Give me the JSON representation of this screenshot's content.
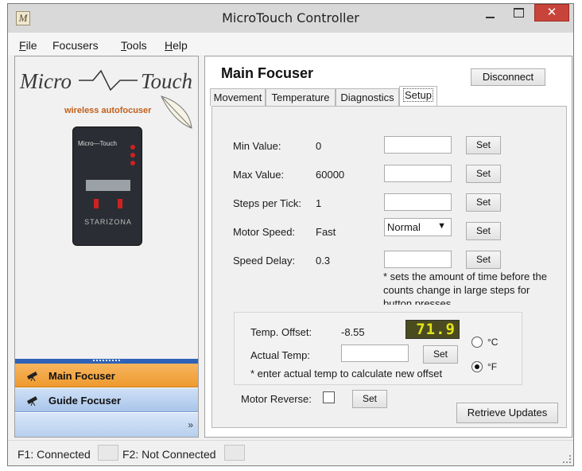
{
  "window": {
    "title": "MicroTouch Controller",
    "icon_letter": "M",
    "close_glyph": "✕"
  },
  "menu": [
    {
      "accel": "F",
      "rest": "ile"
    },
    {
      "accel": "",
      "rest": "Focusers"
    },
    {
      "accel": "T",
      "rest": "ools"
    },
    {
      "accel": "H",
      "rest": "elp"
    }
  ],
  "logo": {
    "part1": "Micro",
    "part2": "Touch",
    "tagline": "wireless autofocuser",
    "device_logo": "Micro—Touch",
    "device_brand": "STARIZONA"
  },
  "nav": {
    "main": "Main Focuser",
    "guide": "Guide Focuser",
    "more": "»"
  },
  "main": {
    "title": "Main Focuser",
    "disconnect": "Disconnect",
    "tabs": [
      "Movement",
      "Temperature",
      "Diagnostics",
      "Setup"
    ],
    "active_tab": "Setup"
  },
  "setup": {
    "min_label": "Min Value:",
    "min_value": "0",
    "max_label": "Max Value:",
    "max_value": "60000",
    "steps_label": "Steps per Tick:",
    "steps_value": "1",
    "speed_label": "Motor Speed:",
    "speed_value": "Fast",
    "speed_select": "Normal",
    "delay_label": "Speed Delay:",
    "delay_value": "0.3",
    "set": "Set",
    "delay_note": "* sets the amount of time before the counts change in large steps for button presses"
  },
  "temp": {
    "offset_label": "Temp. Offset:",
    "offset_value": "-8.55",
    "display": "71.9",
    "actual_label": "Actual Temp:",
    "note": "* enter actual temp to calculate new offset",
    "unit_c": "°C",
    "unit_f": "°F",
    "selected_unit": "°F"
  },
  "reverse": {
    "label": "Motor Reverse:",
    "checked": false
  },
  "retrieve": "Retrieve Updates",
  "status": {
    "f1": "F1:  Connected",
    "f2": "F2:  Not Connected"
  },
  "colors": {
    "active_nav": "#ee9a2f",
    "inactive_nav": "#a9c5ea",
    "close_button": "#c8443a",
    "temp_display_bg": "#4b4b20",
    "temp_display_fg": "#e5e51a",
    "logo_accent": "#c0601a"
  }
}
